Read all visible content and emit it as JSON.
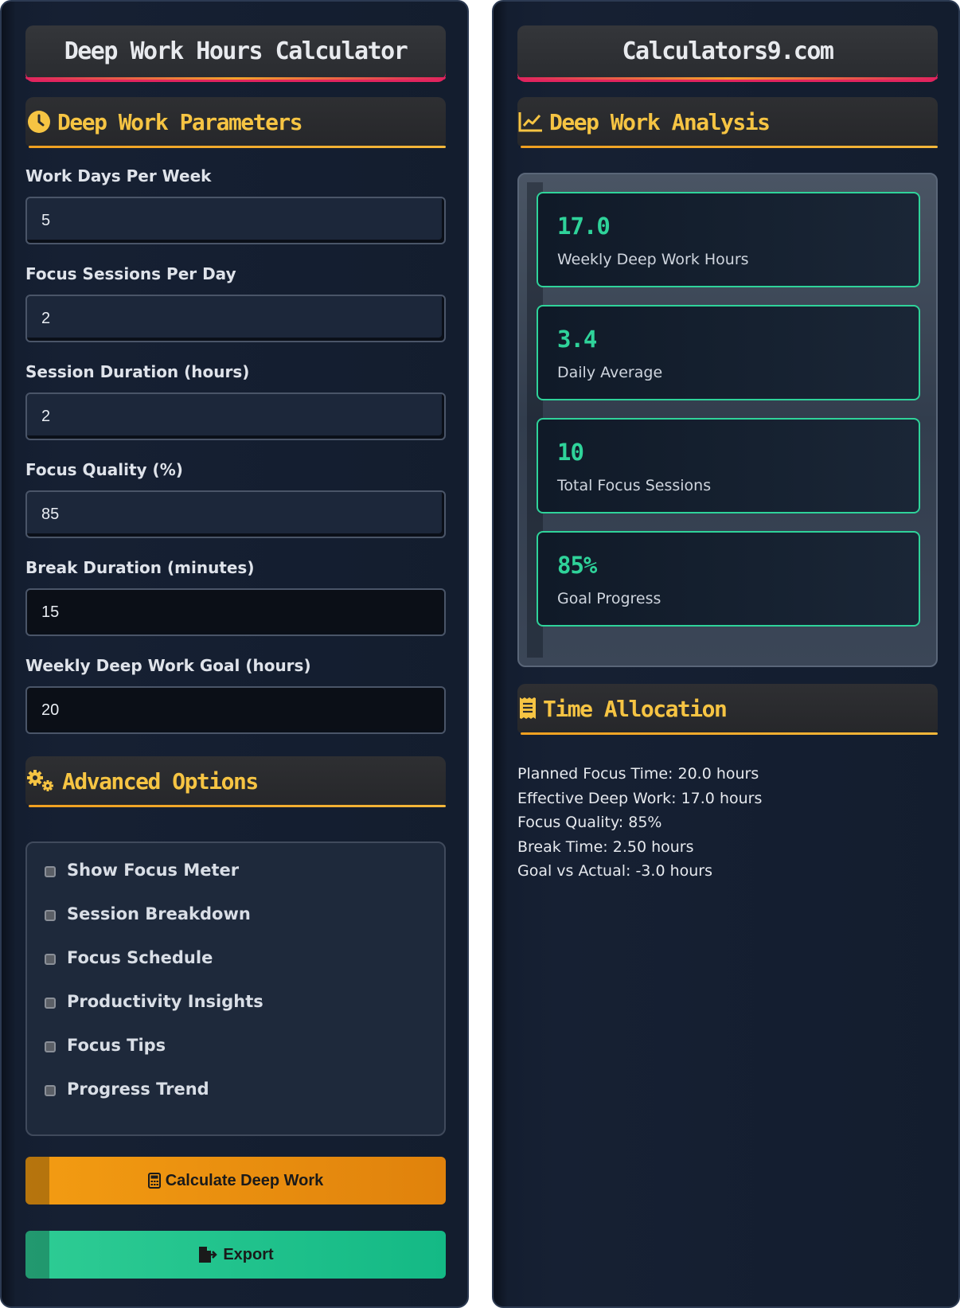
{
  "left": {
    "title": "Deep Work Hours Calculator",
    "params_title": "Deep Work Parameters",
    "fields": [
      {
        "label": "Work Days Per Week",
        "value": "5"
      },
      {
        "label": "Focus Sessions Per Day",
        "value": "2"
      },
      {
        "label": "Session Duration (hours)",
        "value": "2"
      },
      {
        "label": "Focus Quality (%)",
        "value": "85"
      },
      {
        "label": "Break Duration (minutes)",
        "value": "15"
      },
      {
        "label": "Weekly Deep Work Goal (hours)",
        "value": "20"
      }
    ],
    "advanced_title": "Advanced Options",
    "options": [
      {
        "label": "Show Focus Meter"
      },
      {
        "label": "Session Breakdown"
      },
      {
        "label": "Focus Schedule"
      },
      {
        "label": "Productivity Insights"
      },
      {
        "label": "Focus Tips"
      },
      {
        "label": "Progress Trend"
      }
    ],
    "calc_label": "Calculate Deep Work",
    "export_label": "Export"
  },
  "right": {
    "title": "Calculators9.com",
    "analysis_title": "Deep Work Analysis",
    "results": [
      {
        "value": "17.0",
        "label": "Weekly Deep Work Hours"
      },
      {
        "value": "3.4",
        "label": "Daily Average"
      },
      {
        "value": "10",
        "label": "Total Focus Sessions"
      },
      {
        "value": "85%",
        "label": "Goal Progress"
      }
    ],
    "allocation_title": "Time Allocation",
    "allocation": [
      "Planned Focus Time: 20.0 hours",
      "Effective Deep Work: 17.0 hours",
      "Focus Quality: 85%",
      "Break Time: 2.50 hours",
      "Goal vs Actual: -3.0 hours"
    ]
  },
  "colors": {
    "accent": "#f6c443",
    "success": "#2fd39a",
    "primary_button": "#f39c12",
    "export_button": "#1fc58d",
    "header_underline": "#e0245e"
  },
  "icons": {
    "params": "clock-icon",
    "advanced": "gears-icon",
    "analysis": "chart-line-icon",
    "allocation": "receipt-icon",
    "calc": "calculator-icon",
    "export": "file-export-icon"
  }
}
